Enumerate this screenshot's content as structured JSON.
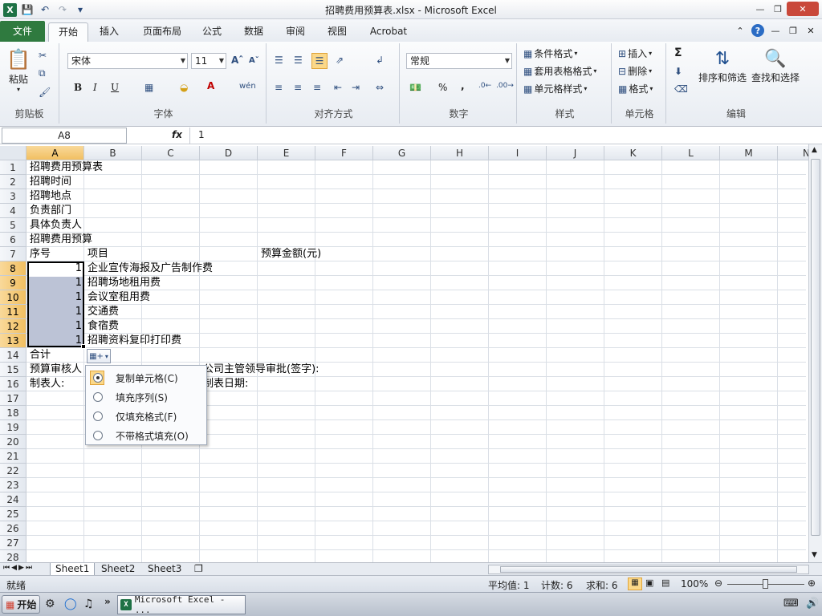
{
  "window": {
    "title": "招聘费用预算表.xlsx - Microsoft Excel"
  },
  "ribbon_tabs": [
    {
      "label": "文件"
    },
    {
      "label": "开始"
    },
    {
      "label": "插入"
    },
    {
      "label": "页面布局"
    },
    {
      "label": "公式"
    },
    {
      "label": "数据"
    },
    {
      "label": "审阅"
    },
    {
      "label": "视图"
    },
    {
      "label": "Acrobat"
    }
  ],
  "ribbon": {
    "clipboard": {
      "paste": "粘贴",
      "label": "剪贴板"
    },
    "font": {
      "name": "宋体",
      "size": "11",
      "label": "字体",
      "bold": "B",
      "italic": "I",
      "underline": "U"
    },
    "alignment": {
      "label": "对齐方式"
    },
    "number": {
      "format": "常规",
      "label": "数字",
      "percent": "%",
      "comma": ","
    },
    "styles": {
      "conditional": "条件格式",
      "table": "套用表格格式",
      "cell": "单元格样式",
      "label": "样式"
    },
    "cells": {
      "insert": "插入",
      "delete": "删除",
      "format": "格式",
      "label": "单元格"
    },
    "editing": {
      "sum": "Σ",
      "sort": "排序和筛选",
      "find": "查找和选择",
      "label": "编辑"
    }
  },
  "formula_bar": {
    "name_box": "A8",
    "fx": "fx",
    "value": "1"
  },
  "columns": [
    "A",
    "B",
    "C",
    "D",
    "E",
    "F",
    "G",
    "H",
    "I",
    "J",
    "K",
    "L",
    "M",
    "N"
  ],
  "rows": [
    "1",
    "2",
    "3",
    "4",
    "5",
    "6",
    "7",
    "8",
    "9",
    "10",
    "11",
    "12",
    "13",
    "14",
    "15",
    "16",
    "17",
    "18",
    "19",
    "20",
    "21",
    "22",
    "23",
    "24",
    "25",
    "26",
    "27",
    "28"
  ],
  "cells": {
    "a1": "招聘费用预算表",
    "a2": "招聘时间",
    "a3": "招聘地点",
    "a4": "负责部门",
    "a5": "具体负责人",
    "a6": "招聘费用预算",
    "a7": "序号",
    "b7": "项目",
    "e7": "预算金额(元)",
    "a8": "1",
    "b8": "企业宣传海报及广告制作费",
    "a9": "1",
    "b9": "招聘场地租用费",
    "a10": "1",
    "b10": "会议室租用费",
    "a11": "1",
    "b11": "交通费",
    "a12": "1",
    "b12": "食宿费",
    "a13": "1",
    "b13": "招聘资料复印打印费",
    "a14": "合计",
    "a15": "预算审核人",
    "d15": "公司主管领导审批(签字):",
    "a16": "制表人:",
    "d16": "制表日期:"
  },
  "autofill_menu": [
    {
      "label": "复制单元格(C)",
      "selected": true
    },
    {
      "label": "填充序列(S)",
      "selected": false
    },
    {
      "label": "仅填充格式(F)",
      "selected": false
    },
    {
      "label": "不带格式填充(O)",
      "selected": false
    }
  ],
  "sheets": [
    {
      "label": "Sheet1"
    },
    {
      "label": "Sheet2"
    },
    {
      "label": "Sheet3"
    }
  ],
  "status": {
    "mode": "就绪",
    "average": "平均值: 1",
    "count": "计数: 6",
    "sum": "求和: 6",
    "zoom": "100%"
  },
  "taskbar": {
    "start": "开始",
    "task": "Microsoft Excel - ..."
  }
}
